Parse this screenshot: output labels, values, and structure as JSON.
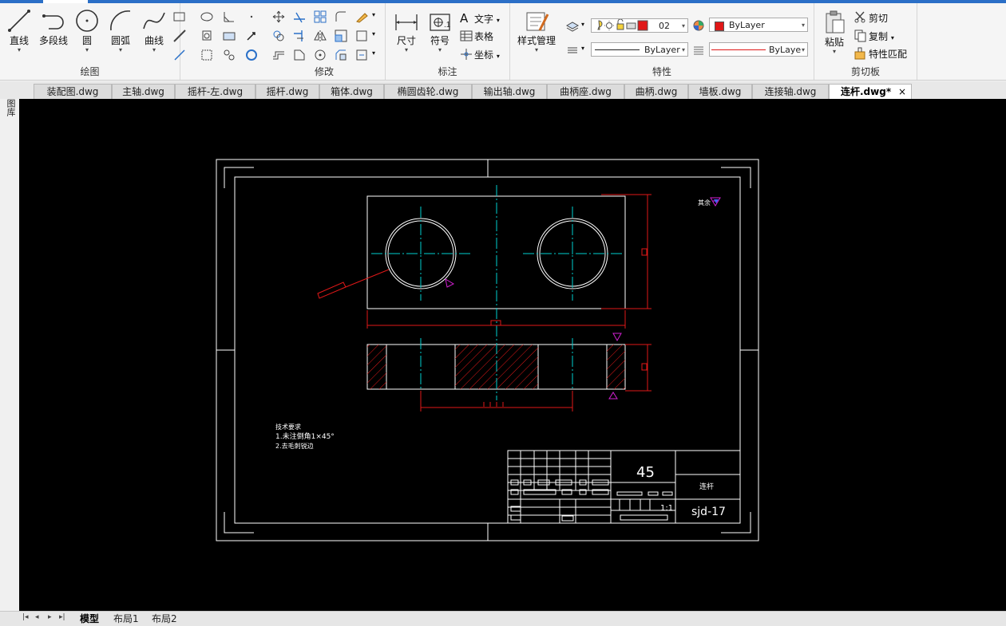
{
  "ribbon": {
    "draw": {
      "title": "绘图",
      "line": "直线",
      "polyline": "多段线",
      "circle": "圆",
      "arc": "圆弧",
      "curve": "曲线"
    },
    "modify": {
      "title": "修改"
    },
    "annotate": {
      "title": "标注",
      "dimension": "尺寸",
      "symbol": "符号",
      "text": "文字",
      "table": "表格",
      "coordinate": "坐标"
    },
    "properties": {
      "title": "特性",
      "style_manager": "样式管理",
      "layer_value": "02",
      "color_value": "ByLayer",
      "linetype_value": "ByLayer",
      "lineweight_value": "ByLaye",
      "accent_red": "#e01818"
    },
    "clipboard": {
      "title": "剪切板",
      "paste": "粘贴",
      "cut": "剪切",
      "copy": "复制",
      "match_props": "特性匹配"
    }
  },
  "sidebar": {
    "label": "图库"
  },
  "tabs": [
    {
      "label": "装配图.dwg"
    },
    {
      "label": "主轴.dwg"
    },
    {
      "label": "摇杆-左.dwg"
    },
    {
      "label": "摇杆.dwg"
    },
    {
      "label": "箱体.dwg"
    },
    {
      "label": "椭圆齿轮.dwg"
    },
    {
      "label": "输出轴.dwg"
    },
    {
      "label": "曲柄座.dwg"
    },
    {
      "label": "曲柄.dwg"
    },
    {
      "label": "墙板.dwg"
    },
    {
      "label": "连接轴.dwg"
    },
    {
      "label": "连杆.dwg*",
      "active": true
    }
  ],
  "tab_close": "×",
  "drawing": {
    "material": "45",
    "part_name": "连杆",
    "drawing_no": "sjd-17",
    "scale": "1:1",
    "roughness_note": "其余",
    "tech_title": "技术要求",
    "tech_line1": "1.未注倒角1×45°",
    "tech_line2": "2.去毛刺锐边",
    "colors": {
      "white": "#ffffff",
      "cyan": "#00d0d0",
      "red": "#e01818",
      "magenta": "#d020d0",
      "blue": "#4060ff"
    }
  },
  "layout_tabs": [
    {
      "label": "模型",
      "active": true
    },
    {
      "label": "布局1"
    },
    {
      "label": "布局2"
    }
  ]
}
